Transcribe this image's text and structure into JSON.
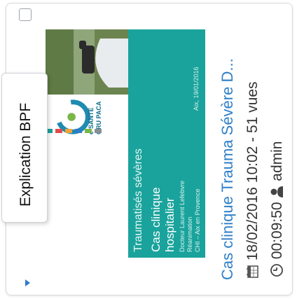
{
  "video_card": {
    "title": "Cas clinique Trauma Sévère D...",
    "date_views": "18/02/2016 10:02 - 51 vues",
    "duration": "00:09:50",
    "author": "admin",
    "tooltip": "Explication BPF",
    "icons": {
      "checkbox": "checkbox-icon",
      "calendar": "calendar-icon",
      "clock": "clock-icon",
      "user": "user-icon",
      "expand": "caret-right-icon"
    },
    "colors": {
      "link": "#2f7fc8",
      "slide_teal": "#1aa39c",
      "caret": "#2d7cc9"
    }
  },
  "slide": {
    "heading": "Traumatisés sévères",
    "subheading_line1": "Cas clinique",
    "subheading_line2": "hospitalier",
    "presenter_line1": "Docteur Laurent Lefebvre",
    "presenter_line2": "Réanimation",
    "presenter_line3": "CHI – Aix en Provence",
    "date_place": "Aix, 19/01/2016",
    "logo_text_line1": "e-SANTÉ",
    "logo_text_line2": "ORU PACA"
  }
}
